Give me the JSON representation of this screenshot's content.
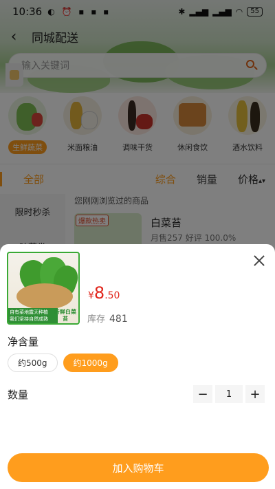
{
  "status_bar": {
    "time": "10:36",
    "battery": "55"
  },
  "header": {
    "title": "同城配送"
  },
  "search": {
    "placeholder": "输入关键词"
  },
  "categories": [
    {
      "label": "生鲜蔬菜",
      "active": true
    },
    {
      "label": "米面粮油",
      "active": false
    },
    {
      "label": "调味干货",
      "active": false
    },
    {
      "label": "休闲食饮",
      "active": false
    },
    {
      "label": "酒水饮料",
      "active": false
    }
  ],
  "filter": {
    "all_label": "全部",
    "sort": [
      "综合",
      "销量",
      "价格"
    ]
  },
  "sidebar": {
    "items": [
      {
        "label": "限时秒杀"
      },
      {
        "label": "叶菜类"
      }
    ]
  },
  "recent": {
    "title": "您刚刚浏览过的商品",
    "badge": "爆款热卖",
    "name": "白菜苔",
    "meta": "月售257 好评 100.0%"
  },
  "sheet": {
    "product_caption_1": "自有菜地露天种植",
    "product_caption_2": "我们坚持自然成熟",
    "product_caption_3": "新鲜白菜苔",
    "price": {
      "currency": "¥",
      "integer": "8",
      "decimal": ".50"
    },
    "stock_label": "库存",
    "stock_value": "481",
    "option_title": "净含量",
    "options": [
      {
        "label": "约500g",
        "selected": false
      },
      {
        "label": "约1000g",
        "selected": true
      }
    ],
    "quantity_title": "数量",
    "quantity": "1",
    "minus": "−",
    "plus": "+",
    "add_to_cart": "加入购物车"
  },
  "colors": {
    "accent": "#ff9d1d",
    "price": "#e1251b",
    "overlay": "rgba(0,0,0,0.5)"
  }
}
